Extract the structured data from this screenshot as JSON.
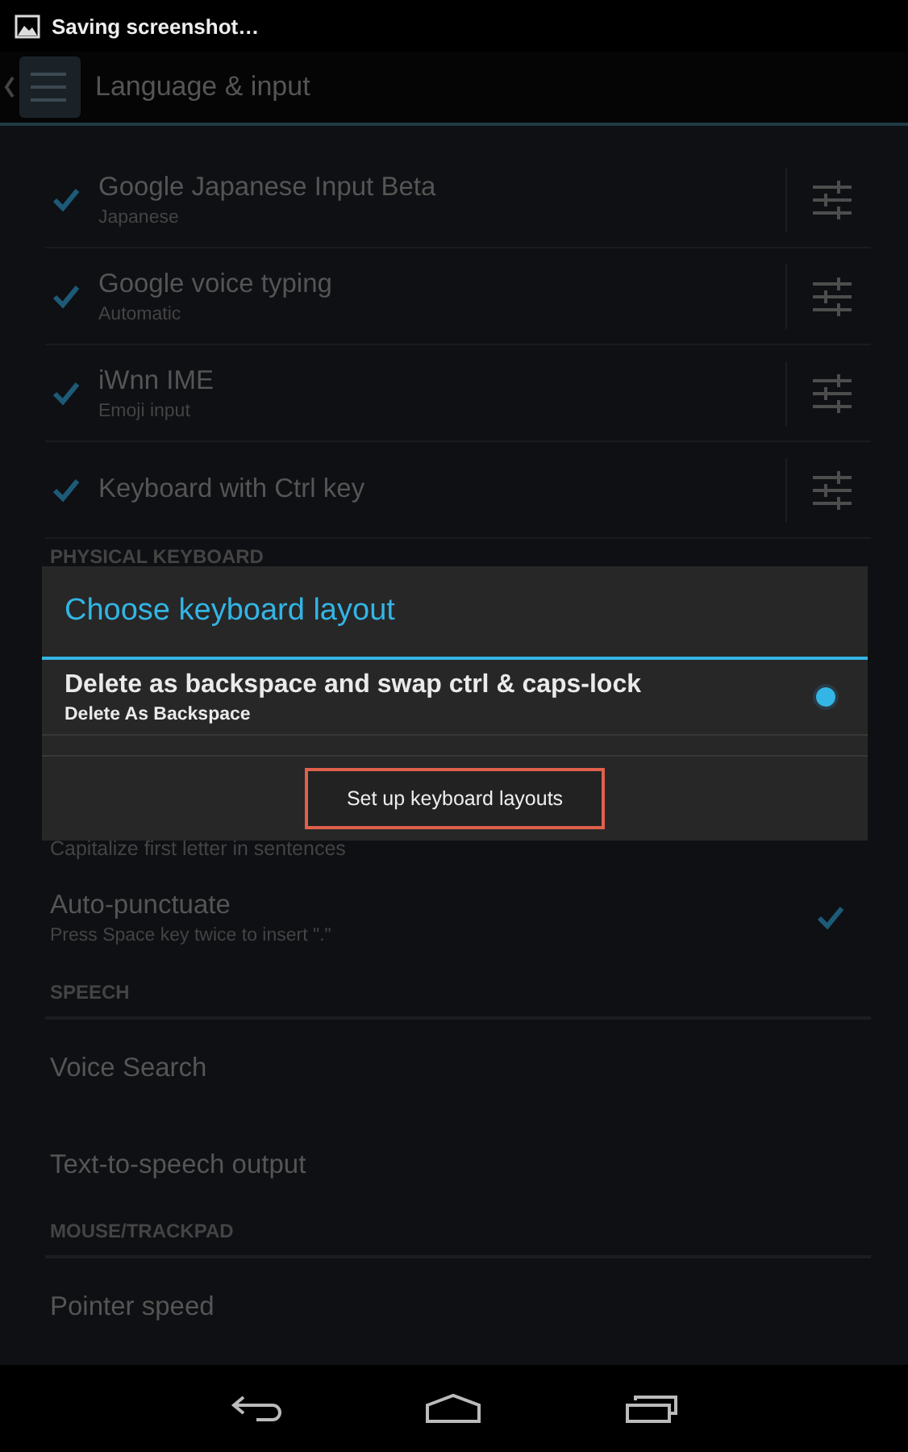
{
  "status_bar": {
    "notification": "Saving screenshot…"
  },
  "action_bar": {
    "title": "Language & input"
  },
  "input_methods": [
    {
      "title": "Google Japanese Input Beta",
      "subtitle": "Japanese",
      "checked": true
    },
    {
      "title": "Google voice typing",
      "subtitle": "Automatic",
      "checked": true
    },
    {
      "title": "iWnn IME",
      "subtitle": "Emoji input",
      "checked": true
    },
    {
      "title": "Keyboard with Ctrl key",
      "checked": true
    }
  ],
  "physical_keyboard_header": "PHYSICAL KEYBOARD",
  "settings": [
    {
      "kind": "caption",
      "text": "Capitalize first letter in sentences"
    },
    {
      "kind": "checkbox",
      "title": "Auto-punctuate",
      "subtitle": "Press Space key twice to insert \".\"",
      "checked": true
    },
    {
      "kind": "header",
      "text": "SPEECH"
    },
    {
      "kind": "item",
      "title": "Voice Search"
    },
    {
      "kind": "item",
      "title": "Text-to-speech output"
    },
    {
      "kind": "header",
      "text": "MOUSE/TRACKPAD"
    },
    {
      "kind": "item",
      "title": "Pointer speed"
    }
  ],
  "dialog": {
    "title": "Choose keyboard layout",
    "options": [
      {
        "title": "Delete as backspace and swap ctrl & caps-lock",
        "subtitle": "Delete As Backspace",
        "selected": true
      }
    ],
    "button": {
      "label": "Set up keyboard layouts",
      "highlighted": true
    }
  }
}
